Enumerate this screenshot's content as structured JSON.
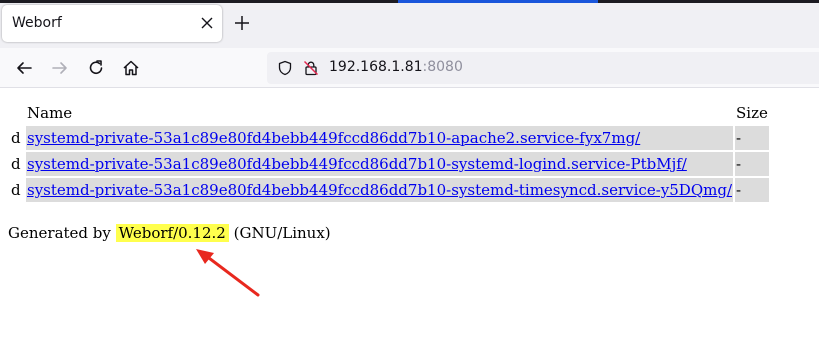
{
  "browser": {
    "tab_title": "Weborf",
    "url_host": "192.168.1.81",
    "url_port": ":8080"
  },
  "listing": {
    "headers": {
      "name": "Name",
      "size": "Size"
    },
    "rows": [
      {
        "type": "d",
        "name": "systemd-private-53a1c89e80fd4bebb449fccd86dd7b10-apache2.service-fyx7mg/",
        "size": "-"
      },
      {
        "type": "d",
        "name": "systemd-private-53a1c89e80fd4bebb449fccd86dd7b10-systemd-logind.service-PtbMjf/",
        "size": "-"
      },
      {
        "type": "d",
        "name": "systemd-private-53a1c89e80fd4bebb449fccd86dd7b10-systemd-timesyncd.service-y5DQmg/",
        "size": "-"
      }
    ]
  },
  "footer": {
    "prefix": "Generated by ",
    "server": "Weborf/0.12.2",
    "suffix": " (GNU/Linux)"
  },
  "colors": {
    "highlight": "#ffff4d",
    "arrow": "#e8281e",
    "row_bg": "#dcdcdc",
    "link": "#0000ee"
  }
}
